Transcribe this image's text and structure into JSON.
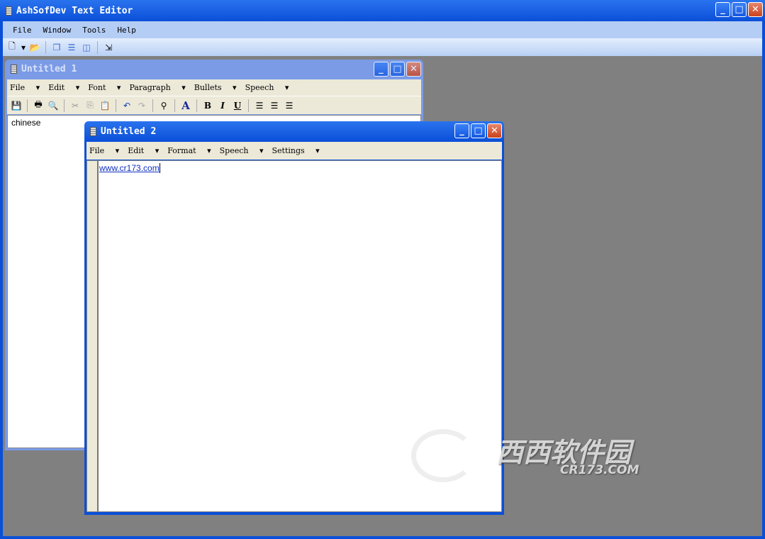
{
  "app": {
    "title": "AshSofDev Text Editor",
    "menu": [
      "File",
      "Window",
      "Tools",
      "Help"
    ]
  },
  "doc1": {
    "title": "Untitled 1",
    "menu": [
      "File",
      "Edit",
      "Font",
      "Paragraph",
      "Bullets",
      "Speech"
    ],
    "content": "chinese"
  },
  "doc2": {
    "title": "Untitled 2",
    "menu": [
      "File",
      "Edit",
      "Format",
      "Speech",
      "Settings"
    ],
    "content": "www.cr173.com"
  },
  "watermark": {
    "text": "西西软件园",
    "sub": "CR173.COM"
  }
}
